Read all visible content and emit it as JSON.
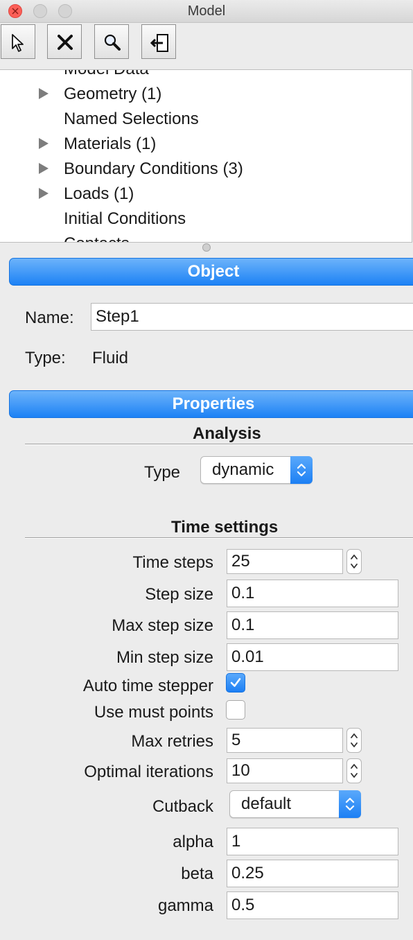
{
  "window": {
    "title": "Model"
  },
  "toolbar": {
    "buttons": [
      {
        "icon": "pointer-arrow-icon"
      },
      {
        "icon": "delete-x-icon"
      },
      {
        "icon": "magnifier-icon"
      },
      {
        "icon": "exit-door-icon"
      }
    ]
  },
  "tree": {
    "items": [
      {
        "label": "Model Data",
        "expandable": false
      },
      {
        "label": "Geometry (1)",
        "expandable": true
      },
      {
        "label": "Named Selections",
        "expandable": false
      },
      {
        "label": "Materials (1)",
        "expandable": true
      },
      {
        "label": "Boundary Conditions (3)",
        "expandable": true
      },
      {
        "label": "Loads (1)",
        "expandable": true
      },
      {
        "label": "Initial Conditions",
        "expandable": false
      },
      {
        "label": "Contacts",
        "expandable": false
      }
    ]
  },
  "object_section": {
    "header": "Object",
    "name_label": "Name:",
    "name_value": "Step1",
    "type_label": "Type:",
    "type_value": "Fluid"
  },
  "properties_section": {
    "header": "Properties",
    "analysis": {
      "title": "Analysis",
      "type_label": "Type",
      "type_value": "dynamic"
    },
    "time_settings": {
      "title": "Time settings",
      "time_steps_label": "Time steps",
      "time_steps_value": "25",
      "step_size_label": "Step size",
      "step_size_value": "0.1",
      "max_step_size_label": "Max step size",
      "max_step_size_value": "0.1",
      "min_step_size_label": "Min step size",
      "min_step_size_value": "0.01",
      "auto_time_stepper_label": "Auto time stepper",
      "auto_time_stepper_checked": true,
      "use_must_points_label": "Use must points",
      "use_must_points_checked": false,
      "max_retries_label": "Max retries",
      "max_retries_value": "5",
      "optimal_iterations_label": "Optimal iterations",
      "optimal_iterations_value": "10",
      "cutback_label": "Cutback",
      "cutback_value": "default",
      "alpha_label": "alpha",
      "alpha_value": "1",
      "beta_label": "beta",
      "beta_value": "0.25",
      "gamma_label": "gamma",
      "gamma_value": "0.5"
    }
  },
  "colors": {
    "accent_blue": "#1d82f5",
    "close_red": "#fc5f57",
    "window_bg": "#ececec"
  }
}
